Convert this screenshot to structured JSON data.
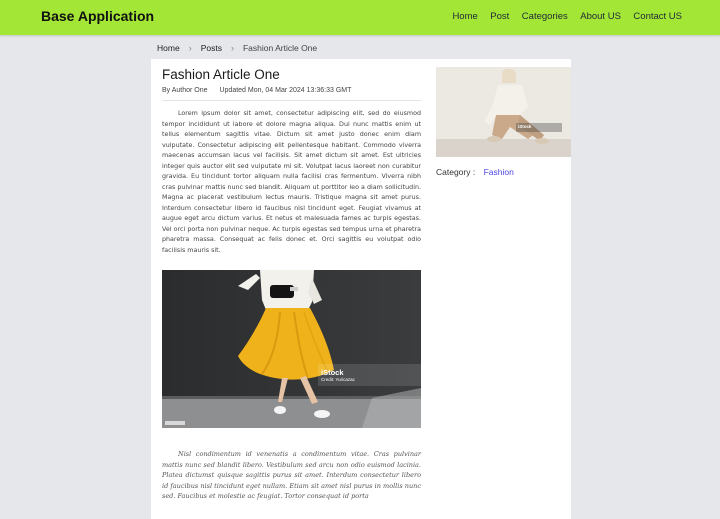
{
  "header": {
    "brand": "Base Application",
    "nav": [
      "Home",
      "Post",
      "Categories",
      "About US",
      "Contact US"
    ]
  },
  "breadcrumb": {
    "items": [
      "Home",
      "Posts"
    ],
    "current": "Fashion Article One"
  },
  "article": {
    "title": "Fashion Article One",
    "author": "By Author One",
    "updated": "Updated Mon, 04 Mar 2024 13:36:33 GMT",
    "body": "Lorem ipsum dolor sit amet, consectetur adipiscing elit, sed do eiusmod tempor incididunt ut labore et dolore magna aliqua. Dui nunc mattis enim ut tellus elementum sagittis vitae. Dictum sit amet justo donec enim diam vulputate. Consectetur adipiscing elit pellentesque habitant. Commodo viverra maecenas accumsan lacus vel facilisis. Sit amet dictum sit amet. Est ultricies integer quis auctor elit sed vulputate mi sit. Volutpat lacus laoreet non curabitur gravida. Eu tincidunt tortor aliquam nulla facilisi cras fermentum. Viverra nibh cras pulvinar mattis nunc sed blandit. Aliquam ut porttitor leo a diam sollicitudin. Magna ac placerat vestibulum lectus mauris. Tristique magna sit amet purus. Interdum consectetur libero id faucibus nisl tincidunt eget. Feugiat vivamus at augue eget arcu dictum varius. Et netus et malesuada fames ac turpis egestas. Vel orci porta non pulvinar neque. Ac turpis egestas sed tempus urna et pharetra pharetra massa. Consequat ac felis donec et. Orci sagittis eu volutpat odio facilisis mauris sit.",
    "image_watermark": "iStock",
    "image_credit": "Credit: Yuricazac",
    "italic_body": "Nisl condimentum id venenatis a condimentum vitae. Cras pulvinar mattis nunc sed blandit libero. Vestibulum sed arcu non odio euismod lacinia. Platea dictumst quisque sagittis purus sit amet. Interdum consectetur libero id faucibus nisl tincidunt eget nullam. Etiam sit amet nisl purus in mollis nunc sed. Faucibus et molestie ac feugiat. Tortor consequat id porta"
  },
  "sidebar": {
    "image_watermark": "iStock",
    "category_label": "Category :",
    "category_value": "Fashion"
  },
  "colors": {
    "navbar": "#a3e635",
    "link": "#4f46e5",
    "skirt": "#f0b21a"
  }
}
